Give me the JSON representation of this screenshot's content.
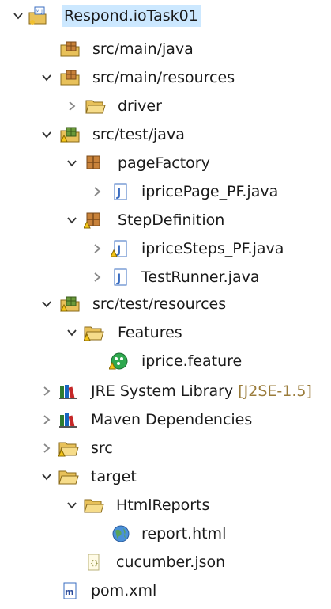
{
  "tree": {
    "project": {
      "label": "Respond.ioTask01"
    },
    "src_main_java": {
      "label": "src/main/java"
    },
    "src_main_resources": {
      "label": "src/main/resources"
    },
    "driver": {
      "label": "driver"
    },
    "src_test_java": {
      "label": "src/test/java"
    },
    "pageFactory": {
      "label": "pageFactory"
    },
    "ipricePage": {
      "label": "ipricePage_PF.java"
    },
    "stepDefinition": {
      "label": "StepDefinition"
    },
    "ipriceSteps": {
      "label": "ipriceSteps_PF.java"
    },
    "testRunner": {
      "label": "TestRunner.java"
    },
    "src_test_resources": {
      "label": "src/test/resources"
    },
    "features": {
      "label": "Features"
    },
    "ipriceFeature": {
      "label": "iprice.feature"
    },
    "jre": {
      "label": "JRE System Library",
      "decoration": "[J2SE-1.5]"
    },
    "maven": {
      "label": "Maven Dependencies"
    },
    "src": {
      "label": "src"
    },
    "target": {
      "label": "target"
    },
    "htmlReports": {
      "label": "HtmlReports"
    },
    "report": {
      "label": "report.html"
    },
    "cucumberJson": {
      "label": "cucumber.json"
    },
    "pom": {
      "label": "pom.xml"
    }
  },
  "colors": {
    "selection": "#cce8ff",
    "decoration": "#9a7b3a",
    "folder": "#e8c15a",
    "package": "#b07030"
  }
}
